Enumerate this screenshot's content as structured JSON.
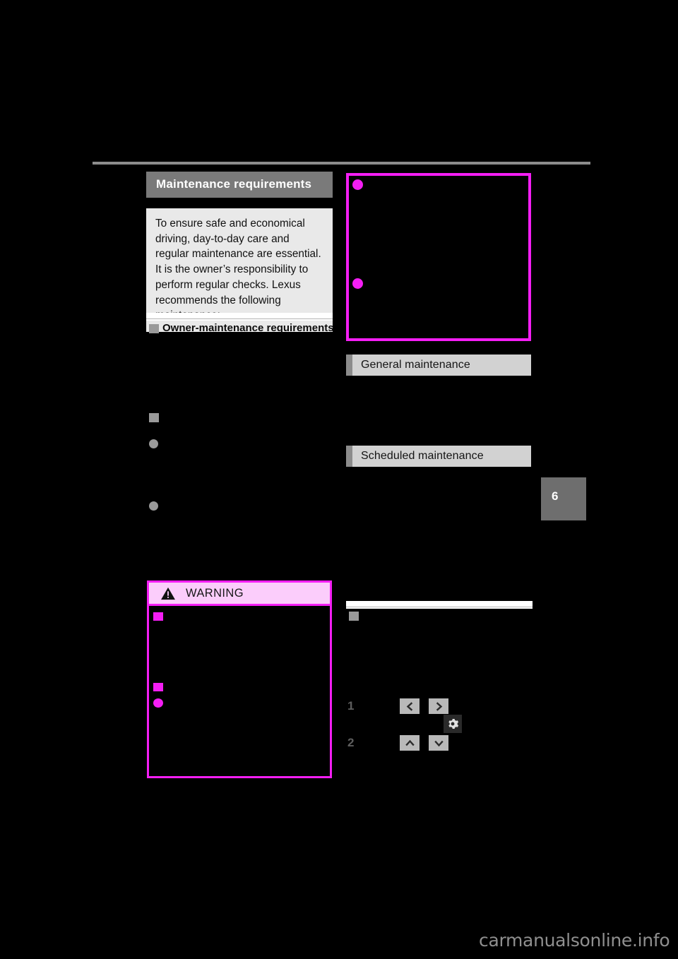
{
  "document": {
    "chapter_number": "6",
    "watermark": "carmanualsonline.info"
  },
  "left_column": {
    "section_title": "Maintenance requirements",
    "intro_paragraph": "To ensure safe and economical driving, day-to-day care and regular maintenance are essential. It is the owner’s responsibility to perform regular checks. Lexus recommends the following maintenance:",
    "subheading_1": "Owner‑maintenance requirements",
    "subheading_2": "",
    "bullet_1": "",
    "bullet_2": "",
    "warning": {
      "label": "WARNING",
      "icon": "warning-triangle-icon",
      "item_1": "",
      "item_2": "",
      "item_3": ""
    }
  },
  "right_column": {
    "figure_caption": "",
    "headings": [
      {
        "label": "General maintenance"
      },
      {
        "label": "Scheduled maintenance"
      }
    ],
    "subheading_bottom": "",
    "steps": [
      {
        "number": "1",
        "buttons": [
          {
            "icon": "chevron-left-icon",
            "label": ""
          },
          {
            "icon": "chevron-right-icon",
            "label": ""
          }
        ]
      },
      {
        "number": "2",
        "buttons": [
          {
            "icon": "chevron-up-icon",
            "label": ""
          },
          {
            "icon": "chevron-down-icon",
            "label": ""
          }
        ]
      }
    ],
    "gear_icon": "gear-icon"
  },
  "colors": {
    "annotation": "#f41ef4",
    "warning_header_bg": "#fbcdfb",
    "section_title_bg": "#7a7a7a",
    "heading_bar_bg": "#d2d2d2",
    "intro_bg": "#e9e9e9",
    "page_bg": "#000000"
  }
}
